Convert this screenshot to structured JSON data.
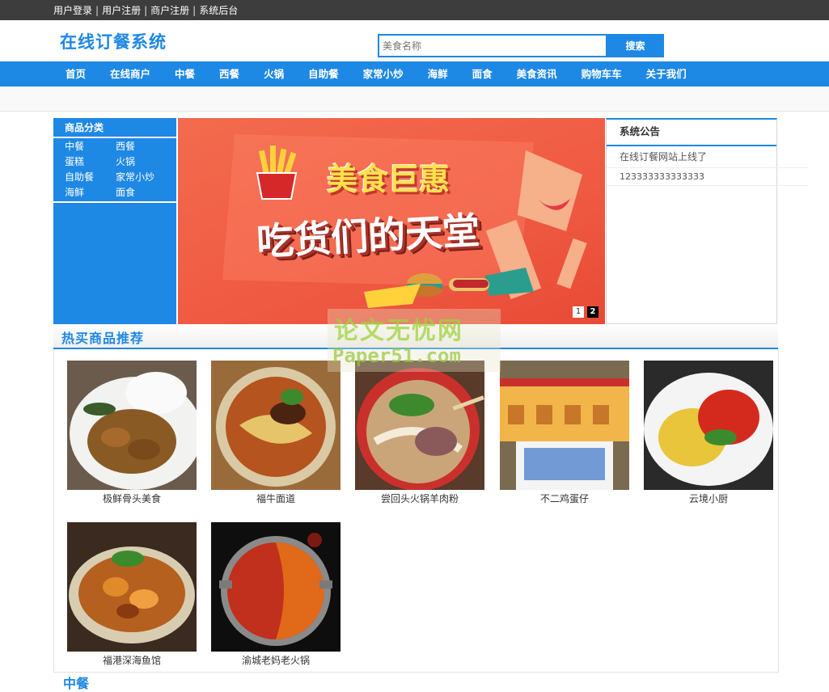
{
  "topbar": {
    "links": [
      "用户登录",
      "用户注册",
      "商户注册",
      "系统后台"
    ],
    "separator": "|"
  },
  "header": {
    "logo": "在线订餐系统",
    "search_placeholder": "美食名称",
    "search_button": "搜索"
  },
  "nav": {
    "items": [
      "首页",
      "在线商户",
      "中餐",
      "西餐",
      "火锅",
      "自助餐",
      "家常小炒",
      "海鲜",
      "面食",
      "美食资讯",
      "购物车车",
      "关于我们"
    ]
  },
  "categories": {
    "title": "商品分类",
    "items": [
      "中餐",
      "西餐",
      "蛋糕",
      "火锅",
      "自助餐",
      "家常小炒",
      "海鲜",
      "面食"
    ]
  },
  "banner": {
    "headline": "美食巨惠",
    "subline": "吃货们的天堂",
    "pages": [
      "1",
      "2"
    ],
    "active_page": "2"
  },
  "notice": {
    "title": "系统公告",
    "items": [
      "在线订餐网站上线了",
      "123333333333333"
    ]
  },
  "hot": {
    "title": "热买商品推荐",
    "products": [
      {
        "name": "极鲜骨头美食",
        "icon": "braised-meat-plate"
      },
      {
        "name": "福牛面道",
        "icon": "beef-noodle-bowl"
      },
      {
        "name": "尝回头火锅羊肉粉",
        "icon": "mutton-noodle-bowl"
      },
      {
        "name": "不二鸡蛋仔",
        "icon": "egg-waffle-shop"
      },
      {
        "name": "云境小厨",
        "icon": "steamed-fish-plate"
      },
      {
        "name": "福港深海鱼馆",
        "icon": "fish-stew-bowl"
      },
      {
        "name": "渝城老妈老火锅",
        "icon": "hotpot"
      }
    ]
  },
  "watermark": {
    "line1": "论文无忧网",
    "line2": "Paper51.com"
  },
  "next_section": {
    "title": "中餐"
  },
  "colors": {
    "accent": "#1e88e5",
    "topbar": "#3d3d3d",
    "banner": "#ef5a42"
  }
}
